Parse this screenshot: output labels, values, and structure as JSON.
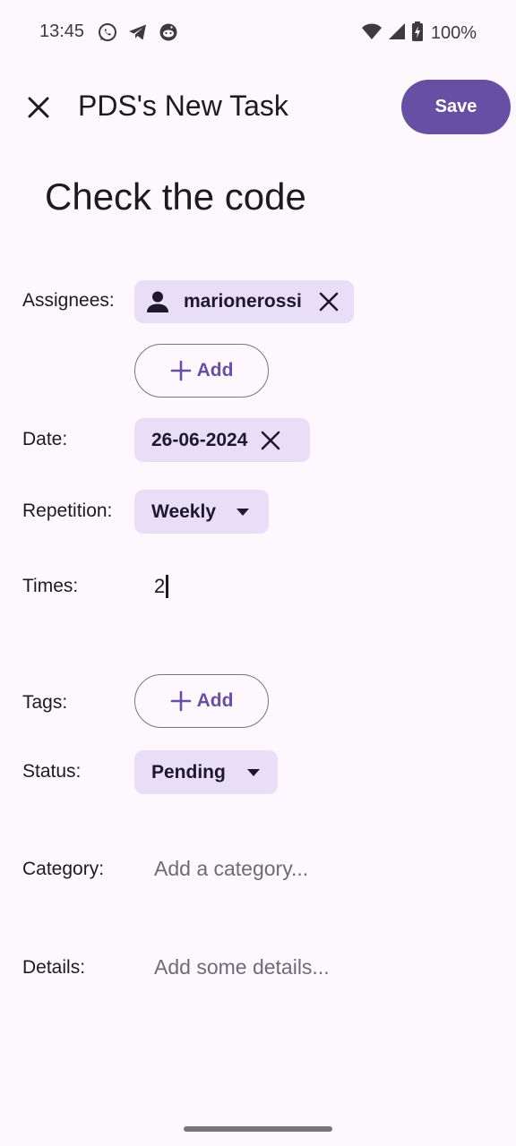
{
  "status_bar": {
    "time": "13:45",
    "app_icons": [
      "whatsapp-icon",
      "telegram-icon",
      "reddit-icon"
    ],
    "system_icons": [
      "wifi-icon",
      "cell-signal-icon",
      "battery-charging-icon"
    ],
    "battery": "100%"
  },
  "top_bar": {
    "title": "PDS's New Task",
    "save_label": "Save",
    "close_icon": "close-icon"
  },
  "task": {
    "title": "Check the code"
  },
  "form": {
    "assignees": {
      "label": "Assignees:",
      "chips": [
        {
          "icon": "person-icon",
          "text": "marionerossi",
          "remove_icon": "close-icon"
        }
      ],
      "add_label": "Add"
    },
    "date": {
      "label": "Date:",
      "value": "26-06-2024"
    },
    "repetition": {
      "label": "Repetition:",
      "value": "Weekly"
    },
    "times": {
      "label": "Times:",
      "value": "2"
    },
    "tags": {
      "label": "Tags:",
      "add_label": "Add"
    },
    "status": {
      "label": "Status:",
      "value": "Pending"
    },
    "category": {
      "label": "Category:",
      "placeholder": "Add a category..."
    },
    "details": {
      "label": "Details:",
      "placeholder": "Add some details..."
    }
  },
  "colors": {
    "background": "#fdf8fd",
    "primary": "#6750a4",
    "chip_background": "#e8def8",
    "outline": "#79747e",
    "text": "#1c1b1f",
    "placeholder": "#6f6b73"
  }
}
